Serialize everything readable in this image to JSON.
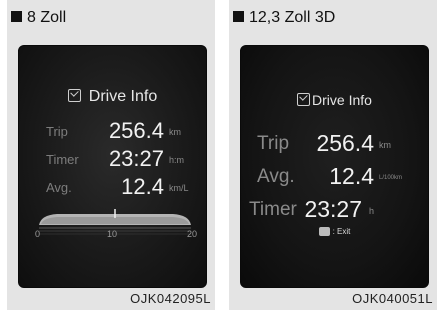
{
  "left_panel": {
    "title": "8 Zoll",
    "code": "OJK042095L",
    "drive_info": {
      "header": "Drive Info",
      "rows": [
        {
          "label": "Trip",
          "value": "256.4",
          "unit": "km"
        },
        {
          "label": "Timer",
          "value": "23:27",
          "unit": "h:m"
        },
        {
          "label": "Avg.",
          "value": "12.4",
          "unit": "km/L"
        }
      ],
      "gauge": {
        "min_label": "0",
        "mid_label": "10",
        "max_label": "20"
      }
    }
  },
  "right_panel": {
    "title": "12,3 Zoll 3D",
    "code": "OJK040051L",
    "drive_info": {
      "header": "Drive Info",
      "rows": [
        {
          "label": "Trip",
          "value": "256.4",
          "unit": "km"
        },
        {
          "label": "Avg.",
          "value": "12.4",
          "unit": "L/100km"
        },
        {
          "label": "Timer",
          "value": "23:27",
          "unit": "h"
        }
      ],
      "exit_label": ": Exit"
    }
  }
}
